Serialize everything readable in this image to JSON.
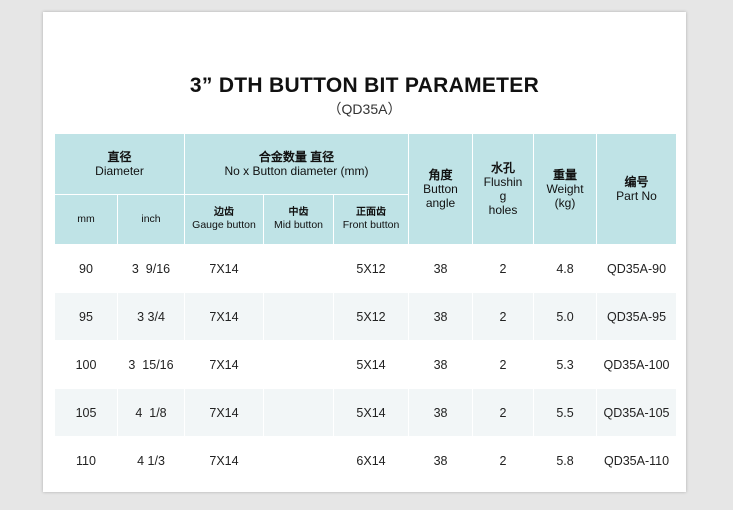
{
  "title": "3” DTH BUTTON BIT PARAMETER",
  "subtitle": "（QD35A）",
  "header": {
    "diameter_zh": "直径",
    "diameter_en": "Diameter",
    "buttons_zh": "合金数量 直径",
    "buttons_en": "No x Button diameter (mm)",
    "angle_zh": "角度",
    "angle_en_1": "Button",
    "angle_en_2": "angle",
    "flush_zh": "水孔",
    "flush_en_1": "Flushin",
    "flush_en_2": "g",
    "flush_en_3": "holes",
    "weight_zh": "重量",
    "weight_en_1": "Weight",
    "weight_en_2": "(kg)",
    "part_zh": "编号",
    "part_en": "Part No",
    "mm": "mm",
    "inch": "inch",
    "gauge_zh": "边齿",
    "gauge_en": "Gauge button",
    "mid_zh": "中齿",
    "mid_en": "Mid button",
    "front_zh": "正面齿",
    "front_en": "Front button"
  },
  "rows": [
    {
      "mm": "90",
      "inch": "3  9/16",
      "gauge": "7X14",
      "mid": "",
      "front": "5X12",
      "angle": "38",
      "holes": "2",
      "weight": "4.8",
      "part": "QD35A-90"
    },
    {
      "mm": "95",
      "inch": "3 3/4",
      "gauge": "7X14",
      "mid": "",
      "front": "5X12",
      "angle": "38",
      "holes": "2",
      "weight": "5.0",
      "part": "QD35A-95"
    },
    {
      "mm": "100",
      "inch": "3  15/16",
      "gauge": "7X14",
      "mid": "",
      "front": "5X14",
      "angle": "38",
      "holes": "2",
      "weight": "5.3",
      "part": "QD35A-100"
    },
    {
      "mm": "105",
      "inch": "4  1/8",
      "gauge": "7X14",
      "mid": "",
      "front": "5X14",
      "angle": "38",
      "holes": "2",
      "weight": "5.5",
      "part": "QD35A-105"
    },
    {
      "mm": "110",
      "inch": "4 1/3",
      "gauge": "7X14",
      "mid": "",
      "front": "6X14",
      "angle": "38",
      "holes": "2",
      "weight": "5.8",
      "part": "QD35A-110"
    }
  ]
}
